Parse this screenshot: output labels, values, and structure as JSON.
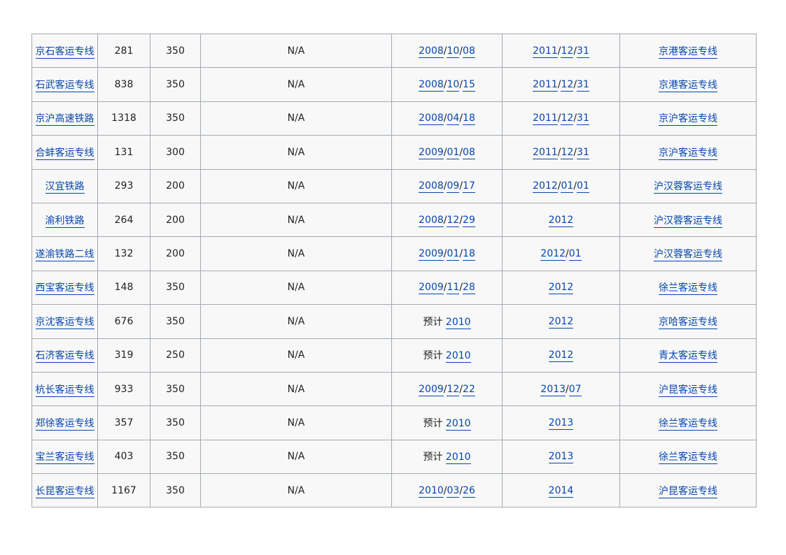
{
  "colors": {
    "link": "#0645ad",
    "cell_bg": "#f8f8f8",
    "border": "#a2a9b1"
  },
  "rows": [
    {
      "name": "京石客运专线",
      "length": "281",
      "speed": "350",
      "extra": "N/A",
      "start": {
        "prefix": "",
        "parts": [
          "2008",
          "10",
          "08"
        ]
      },
      "end": {
        "prefix": "",
        "parts": [
          "2011",
          "12",
          "31"
        ]
      },
      "line": "京港客运专线"
    },
    {
      "name": "石武客运专线",
      "length": "838",
      "speed": "350",
      "extra": "N/A",
      "start": {
        "prefix": "",
        "parts": [
          "2008",
          "10",
          "15"
        ]
      },
      "end": {
        "prefix": "",
        "parts": [
          "2011",
          "12",
          "31"
        ]
      },
      "line": "京港客运专线"
    },
    {
      "name": "京沪高速铁路",
      "length": "1318",
      "speed": "350",
      "extra": "N/A",
      "start": {
        "prefix": "",
        "parts": [
          "2008",
          "04",
          "18"
        ]
      },
      "end": {
        "prefix": "",
        "parts": [
          "2011",
          "12",
          "31"
        ]
      },
      "line": "京沪客运专线"
    },
    {
      "name": "合蚌客运专线",
      "length": "131",
      "speed": "300",
      "extra": "N/A",
      "start": {
        "prefix": "",
        "parts": [
          "2009",
          "01",
          "08"
        ]
      },
      "end": {
        "prefix": "",
        "parts": [
          "2011",
          "12",
          "31"
        ]
      },
      "line": "京沪客运专线"
    },
    {
      "name": "汉宜铁路",
      "length": "293",
      "speed": "200",
      "extra": "N/A",
      "start": {
        "prefix": "",
        "parts": [
          "2008",
          "09",
          "17"
        ]
      },
      "end": {
        "prefix": "",
        "parts": [
          "2012",
          "01",
          "01"
        ]
      },
      "line": "沪汉蓉客运专线"
    },
    {
      "name": "渝利铁路",
      "length": "264",
      "speed": "200",
      "extra": "N/A",
      "start": {
        "prefix": "",
        "parts": [
          "2008",
          "12",
          "29"
        ]
      },
      "end": {
        "prefix": "",
        "parts": [
          "2012"
        ]
      },
      "line": "沪汉蓉客运专线"
    },
    {
      "name": "遂渝铁路二线",
      "length": "132",
      "speed": "200",
      "extra": "N/A",
      "start": {
        "prefix": "",
        "parts": [
          "2009",
          "01",
          "18"
        ]
      },
      "end": {
        "prefix": "",
        "parts": [
          "2012",
          "01"
        ]
      },
      "line": "沪汉蓉客运专线"
    },
    {
      "name": "西宝客运专线",
      "length": "148",
      "speed": "350",
      "extra": "N/A",
      "start": {
        "prefix": "",
        "parts": [
          "2009",
          "11",
          "28"
        ]
      },
      "end": {
        "prefix": "",
        "parts": [
          "2012"
        ]
      },
      "line": "徐兰客运专线"
    },
    {
      "name": "京沈客运专线",
      "length": "676",
      "speed": "350",
      "extra": "N/A",
      "start": {
        "prefix": "预计",
        "parts": [
          "2010"
        ]
      },
      "end": {
        "prefix": "",
        "parts": [
          "2012"
        ]
      },
      "line": "京哈客运专线"
    },
    {
      "name": "石济客运专线",
      "length": "319",
      "speed": "250",
      "extra": "N/A",
      "start": {
        "prefix": "预计",
        "parts": [
          "2010"
        ]
      },
      "end": {
        "prefix": "",
        "parts": [
          "2012"
        ]
      },
      "line": "青太客运专线"
    },
    {
      "name": "杭长客运专线",
      "length": "933",
      "speed": "350",
      "extra": "N/A",
      "start": {
        "prefix": "",
        "parts": [
          "2009",
          "12",
          "22"
        ]
      },
      "end": {
        "prefix": "",
        "parts": [
          "2013",
          "07"
        ]
      },
      "line": "沪昆客运专线"
    },
    {
      "name": "郑徐客运专线",
      "length": "357",
      "speed": "350",
      "extra": "N/A",
      "start": {
        "prefix": "预计",
        "parts": [
          "2010"
        ]
      },
      "end": {
        "prefix": "",
        "parts": [
          "2013"
        ]
      },
      "line": "徐兰客运专线"
    },
    {
      "name": "宝兰客运专线",
      "length": "403",
      "speed": "350",
      "extra": "N/A",
      "start": {
        "prefix": "预计",
        "parts": [
          "2010"
        ]
      },
      "end": {
        "prefix": "",
        "parts": [
          "2013"
        ]
      },
      "line": "徐兰客运专线"
    },
    {
      "name": "长昆客运专线",
      "length": "1167",
      "speed": "350",
      "extra": "N/A",
      "start": {
        "prefix": "",
        "parts": [
          "2010",
          "03",
          "26"
        ]
      },
      "end": {
        "prefix": "",
        "parts": [
          "2014"
        ]
      },
      "line": "沪昆客运专线"
    }
  ]
}
